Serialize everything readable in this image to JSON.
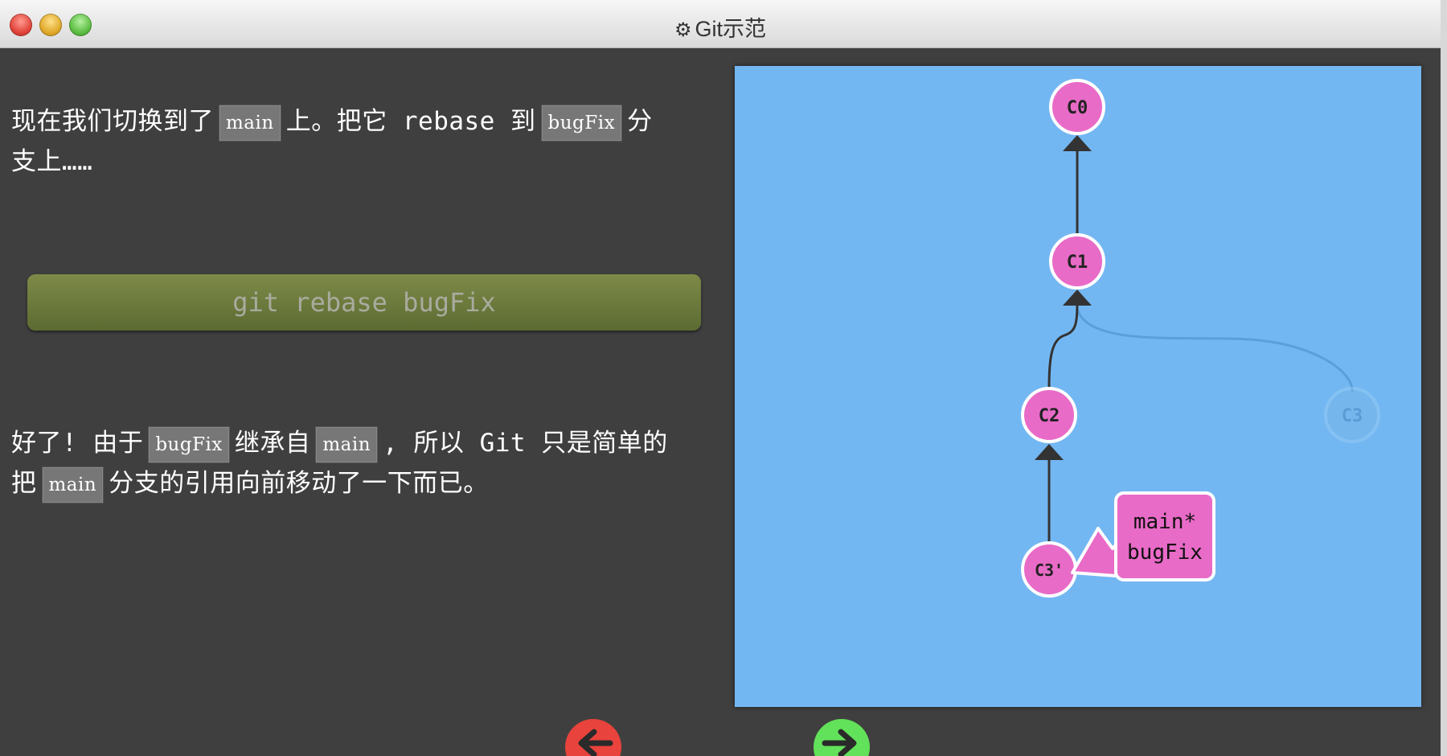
{
  "window": {
    "title": "Git示范",
    "title_icon": "gear-icon"
  },
  "text": {
    "p1_a": "现在我们切换到了",
    "p1_code1": "main",
    "p1_b": "上。把它 rebase 到",
    "p1_code2": "bugFix",
    "p1_c": "分",
    "p1_d": "支上……",
    "command": "git rebase bugFix",
    "p2_a": "好了! 由于",
    "p2_code1": "bugFix",
    "p2_b": "继承自",
    "p2_code2": "main",
    "p2_c": ", 所以 Git 只是简单的",
    "p2_d": "把",
    "p2_code3": "main",
    "p2_e": "分支的引用向前移动了一下而已。"
  },
  "graph": {
    "commits": [
      "C0",
      "C1",
      "C2",
      "C3'",
      "C3"
    ],
    "faded_commit": "C3",
    "branch_label_line1": "main*",
    "branch_label_line2": "bugFix"
  },
  "colors": {
    "canvas": "#73b7f2",
    "commit": "#e86bc7",
    "command_bar": "#6b7a3c",
    "back_button": "#e8433c",
    "forward_button": "#62e25a"
  }
}
